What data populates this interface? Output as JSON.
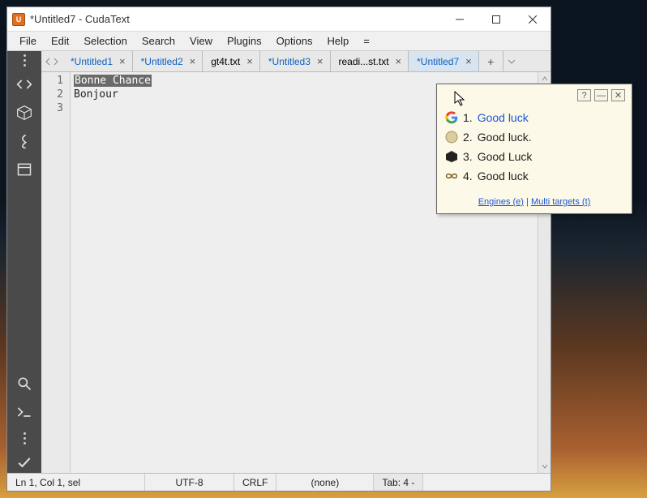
{
  "window": {
    "title": "*Untitled7 - CudaText"
  },
  "menu": {
    "items": [
      "File",
      "Edit",
      "Selection",
      "Search",
      "View",
      "Plugins",
      "Options",
      "Help",
      "="
    ]
  },
  "tabs": {
    "items": [
      {
        "label": "*Untitled1",
        "modified": true,
        "active": false
      },
      {
        "label": "*Untitled2",
        "modified": true,
        "active": false
      },
      {
        "label": "gt4t.txt",
        "modified": false,
        "active": false
      },
      {
        "label": "*Untitled3",
        "modified": true,
        "active": false
      },
      {
        "label": "readi...st.txt",
        "modified": false,
        "active": false
      },
      {
        "label": "*Untitled7",
        "modified": true,
        "active": true
      }
    ]
  },
  "editor": {
    "gutter": [
      "1",
      "2",
      "3"
    ],
    "line1_selected": "Bonne Chance",
    "line2": "",
    "line3": "Bonjour"
  },
  "status": {
    "pos": "Ln 1, Col 1, sel",
    "encoding": "UTF-8",
    "lineend": "CRLF",
    "lexer": "(none)",
    "tab": "Tab: 4  -"
  },
  "popup": {
    "items": [
      {
        "n": "1.",
        "text": "Good luck",
        "engine": "google"
      },
      {
        "n": "2.",
        "text": "Good luck.",
        "engine": "deepl"
      },
      {
        "n": "3.",
        "text": "Good Luck",
        "engine": "cube"
      },
      {
        "n": "4.",
        "text": "Good luck",
        "engine": "infinity"
      }
    ],
    "engines_label": "Engines (e)",
    "multi_label": "Multi targets (t)"
  }
}
